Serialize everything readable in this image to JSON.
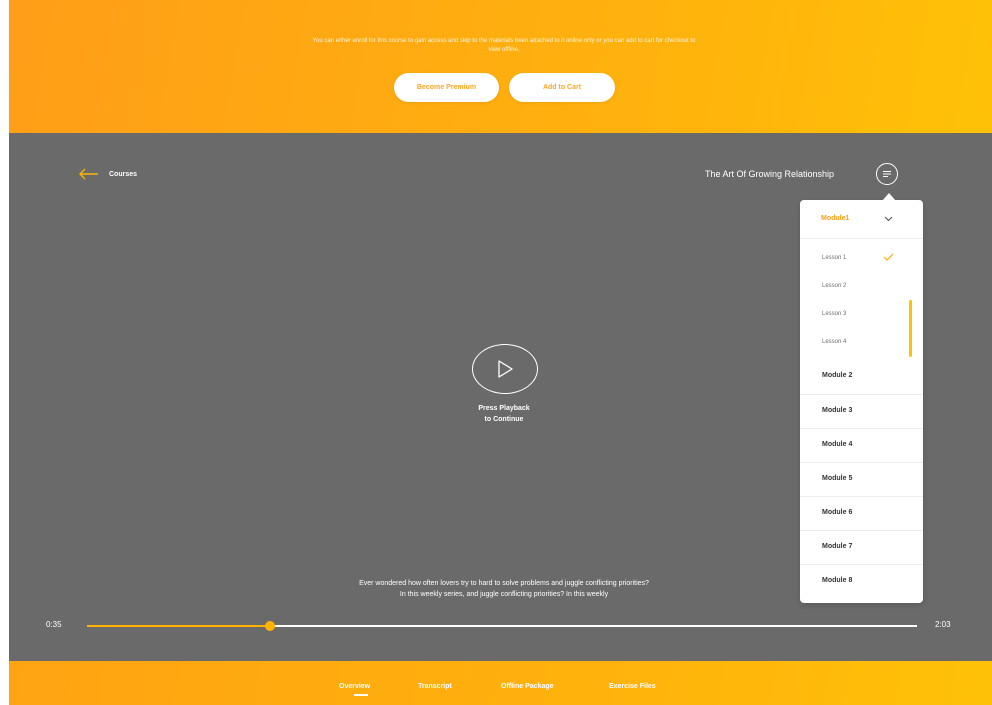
{
  "banner": {
    "message": "You can either enroll for this course to gain access and skip to the materials been attached to it online only or you can add to cart for checkout to view offline.",
    "become_premium_label": "Become Premium",
    "add_to_cart_label": "Add to Cart"
  },
  "player": {
    "back_label": "Courses",
    "course_title": "The Art Of Growing Relationship",
    "play_label_line1": "Press Playback",
    "play_label_line2": "to Continue",
    "caption_line1": "Ever wondered how often lovers try to hard to solve problems and juggle conflicting priorities?",
    "caption_line2": "In this weekly series, and juggle conflicting priorities? In this weekly",
    "time_current": "0:35",
    "time_total": "2:03",
    "progress_fraction": 0.22
  },
  "modules_panel": {
    "active_module": "Module1",
    "lessons": [
      "Lesson 1",
      "Lesson 2",
      "Lesson 3",
      "Lesson 4"
    ],
    "completed_lesson_index": 0,
    "modules": [
      "Module 2",
      "Module 3",
      "Module 4",
      "Module 5",
      "Module 6",
      "Module 7",
      "Module 8"
    ]
  },
  "footer": {
    "tabs": [
      "Overview",
      "Transcript",
      "Offline Package",
      "Exercise Files"
    ],
    "active_tab_index": 0
  },
  "colors": {
    "accent": "#ffb300",
    "banner_orange": "#ff9e18",
    "player_bg": "#6a6a6a"
  },
  "icons": {
    "back": "arrow-left-icon",
    "menu": "list-menu-icon",
    "play": "play-icon",
    "chevron": "chevron-down-icon",
    "check": "check-icon"
  }
}
